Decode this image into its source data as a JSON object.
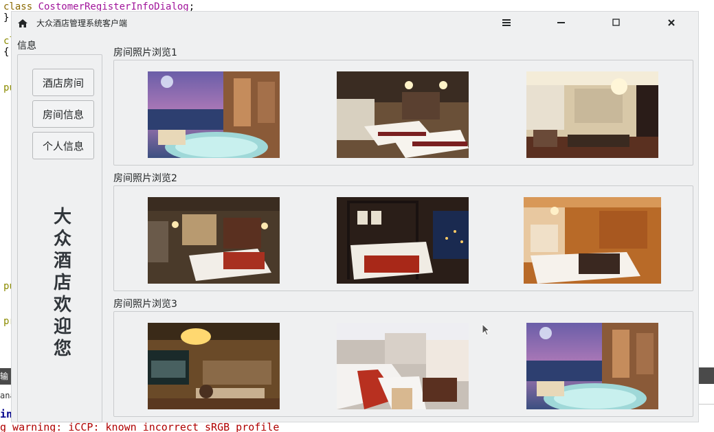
{
  "background": {
    "code_line_1": "class CostomerRegisterInfoDialog;",
    "code_line_2": "}",
    "code_line_3": "cl",
    "code_line_4": "{",
    "code_line_5": "pu",
    "code_line_6": "pu",
    "code_line_7": "pr",
    "tab_text": "输",
    "ana_text": "ana",
    "in_text": "in",
    "warning_text": "g warning: iCCP: known incorrect sRGB profile"
  },
  "window": {
    "title": "大众酒店管理系统客户端"
  },
  "sidebar": {
    "group_title": "信息",
    "buttons": [
      "酒店房间",
      "房间信息",
      "个人信息"
    ],
    "welcome_text": "大众酒店欢迎您"
  },
  "galleries": [
    {
      "title": "房间照片浏览1"
    },
    {
      "title": "房间照片浏览2"
    },
    {
      "title": "房间照片浏览3"
    }
  ]
}
